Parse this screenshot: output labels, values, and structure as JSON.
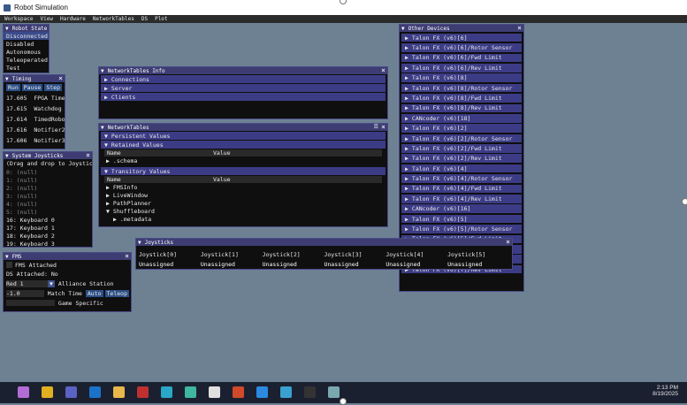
{
  "window": {
    "title": "Robot Simulation"
  },
  "menubar": {
    "items": [
      "Workspace",
      "View",
      "Hardware",
      "NetworkTables",
      "DS",
      "Plot"
    ]
  },
  "robot_state": {
    "title": "Robot State",
    "items": [
      "Disconnected",
      "Disabled",
      "Autonomous",
      "Teleoperated",
      "Test"
    ]
  },
  "timing": {
    "title": "Timing",
    "buttons": [
      "Run",
      "Pause",
      "Step"
    ],
    "rows": [
      {
        "value": "17.605",
        "label": "FPGA Time"
      },
      {
        "value": "17.615",
        "label": "Watchdog"
      },
      {
        "value": "17.614",
        "label": "TimedRobot"
      },
      {
        "value": "17.616",
        "label": "Notifier2"
      },
      {
        "value": "17.606",
        "label": "Notifier3"
      }
    ]
  },
  "system_joysticks": {
    "title": "System Joysticks",
    "hint": "(Drag and drop to Joysticks)",
    "items": [
      "0: (null)",
      "1: (null)",
      "2: (null)",
      "3: (null)",
      "4: (null)",
      "5: (null)",
      "16: Keyboard 0",
      "17: Keyboard 1",
      "18: Keyboard 2",
      "19: Keyboard 3"
    ]
  },
  "fms": {
    "title": "FMS",
    "fms_attached": "FMS Attached",
    "ds_attached": "DS Attached:  No",
    "alliance_value": "Red 1",
    "alliance_label": "Alliance Station",
    "match_time_value": "-1.0",
    "match_time_label": "Match Time",
    "auto_btn": "Auto",
    "teleop_btn": "Teleop",
    "game_specific": "Game Specific"
  },
  "nt_info": {
    "title": "NetworkTables Info",
    "sections": [
      "Connections",
      "Server",
      "Clients"
    ]
  },
  "networktables": {
    "title": "NetworkTables",
    "persistent": "Persistent Values",
    "retained": "Retained Values",
    "col_name": "Name",
    "col_value": "Value",
    "retained_rows": [
      ".schema"
    ],
    "transitory": "Transitory Values",
    "transitory_rows": [
      "FMSInfo",
      "LiveWindow",
      "PathPlanner",
      "Shuffleboard",
      ".metadata"
    ]
  },
  "joysticks": {
    "title": "Joysticks",
    "columns": [
      "Joystick[0]",
      "Joystick[1]",
      "Joystick[2]",
      "Joystick[3]",
      "Joystick[4]",
      "Joystick[5]"
    ],
    "values": [
      "Unassigned",
      "Unassigned",
      "Unassigned",
      "Unassigned",
      "Unassigned",
      "Unassigned"
    ]
  },
  "other_devices": {
    "title": "Other Devices",
    "items": [
      "Talon FX (v6)[6]",
      "Talon FX (v6)[6]/Rotor Sensor",
      "Talon FX (v6)[6]/Fwd Limit",
      "Talon FX (v6)[6]/Rev Limit",
      "Talon FX (v6)[8]",
      "Talon FX (v6)[8]/Rotor Sensor",
      "Talon FX (v6)[8]/Fwd Limit",
      "Talon FX (v6)[8]/Rev Limit",
      "CANcoder (v6)[18]",
      "Talon FX (v6)[2]",
      "Talon FX (v6)[2]/Rotor Sensor",
      "Talon FX (v6)[2]/Fwd Limit",
      "Talon FX (v6)[2]/Rev Limit",
      "Talon FX (v6)[4]",
      "Talon FX (v6)[4]/Rotor Sensor",
      "Talon FX (v6)[4]/Fwd Limit",
      "Talon FX (v6)[4]/Rev Limit",
      "CANcoder (v6)[16]",
      "Talon FX (v6)[5]",
      "Talon FX (v6)[5]/Rotor Sensor",
      "Talon FX (v6)[5]/Fwd Limit",
      "Talon FX (v6)[7]/Rotor Sensor",
      "Talon FX (v6)[7]/Fwd Limit",
      "Talon FX (v6)[7]/Rev Limit"
    ]
  },
  "taskbar": {
    "time": "2:13 PM",
    "date": "8/19/2025",
    "icons": [
      {
        "name": "copilot-icon",
        "color": "#b36bd6"
      },
      {
        "name": "chrome-icon",
        "color": "#e0b020"
      },
      {
        "name": "teams-icon",
        "color": "#5a62c4"
      },
      {
        "name": "outlook-icon",
        "color": "#1a73c8"
      },
      {
        "name": "file-explorer-icon",
        "color": "#e8b84a"
      },
      {
        "name": "code-brackets-icon",
        "color": "#c03030"
      },
      {
        "name": "edge-icon",
        "color": "#2aa6c8"
      },
      {
        "name": "chrome-dev-icon",
        "color": "#3fb6a0"
      },
      {
        "name": "github-icon",
        "color": "#e0e0e0"
      },
      {
        "name": "powerpoint-icon",
        "color": "#d04a2a"
      },
      {
        "name": "vscode-icon",
        "color": "#2a8ae0"
      },
      {
        "name": "sim-app-icon",
        "color": "#3aa0d0"
      },
      {
        "name": "terminal-icon",
        "color": "#333333"
      },
      {
        "name": "robot-sim-icon",
        "color": "#7aa8b0"
      }
    ]
  }
}
